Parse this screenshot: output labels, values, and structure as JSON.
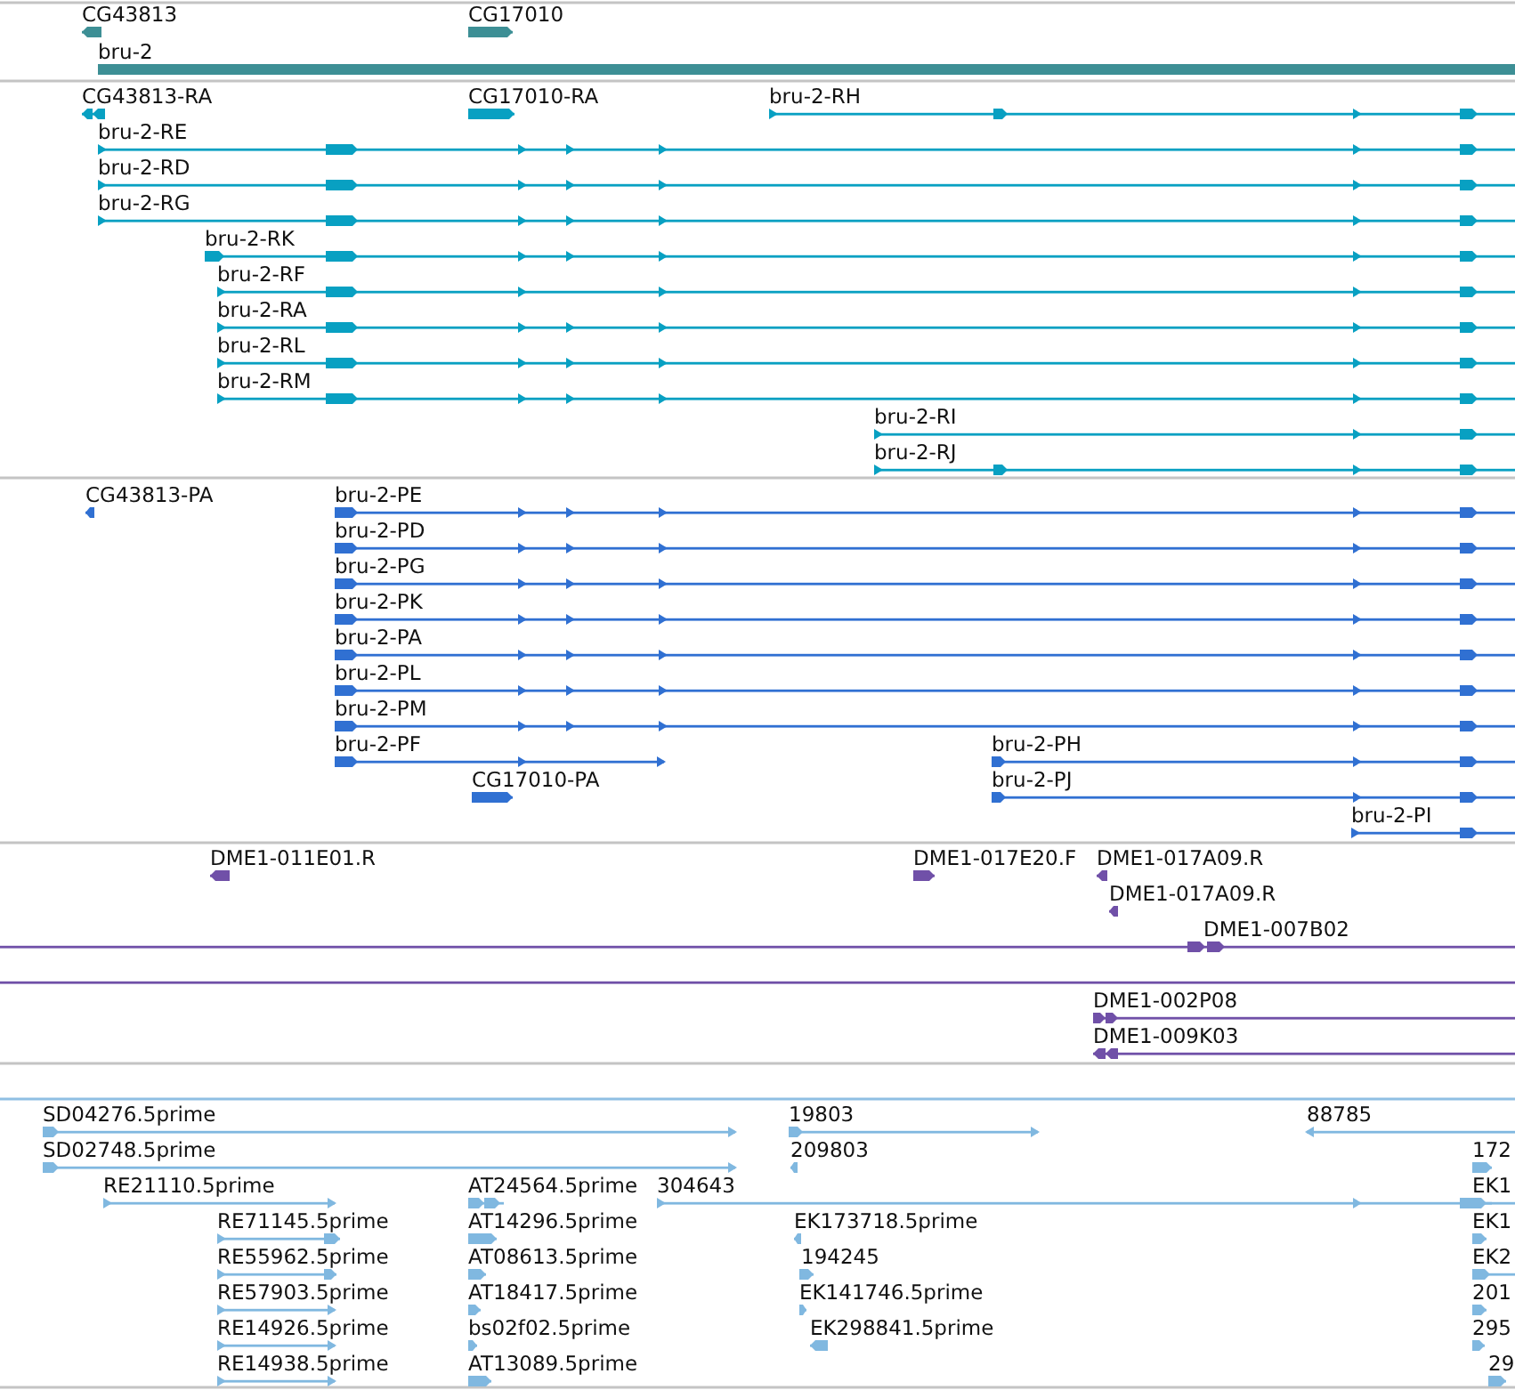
{
  "tracks": [
    {
      "color": "#3d8f95",
      "features": [
        {
          "label": "CG43813",
          "reverse": true
        },
        {
          "label": "CG17010",
          "reverse": false
        },
        {
          "label": "bru-2"
        }
      ]
    },
    {
      "color": "#08a0c2",
      "features": [
        {
          "label": "CG43813-RA",
          "reverse": true
        },
        {
          "label": "CG17010-RA",
          "reverse": false
        },
        {
          "label": "bru-2-RH",
          "reverse": false
        },
        {
          "label": "bru-2-RE",
          "reverse": false
        },
        {
          "label": "bru-2-RD",
          "reverse": false
        },
        {
          "label": "bru-2-RG",
          "reverse": false
        },
        {
          "label": "bru-2-RK",
          "reverse": false
        },
        {
          "label": "bru-2-RF",
          "reverse": false
        },
        {
          "label": "bru-2-RA",
          "reverse": false
        },
        {
          "label": "bru-2-RL",
          "reverse": false
        },
        {
          "label": "bru-2-RM",
          "reverse": false
        },
        {
          "label": "bru-2-RI",
          "reverse": false
        },
        {
          "label": "bru-2-RJ",
          "reverse": false
        }
      ]
    },
    {
      "color": "#3070d2",
      "features": [
        {
          "label": "CG43813-PA",
          "reverse": true
        },
        {
          "label": "bru-2-PE",
          "reverse": false
        },
        {
          "label": "bru-2-PD",
          "reverse": false
        },
        {
          "label": "bru-2-PG",
          "reverse": false
        },
        {
          "label": "bru-2-PK",
          "reverse": false
        },
        {
          "label": "bru-2-PA",
          "reverse": false
        },
        {
          "label": "bru-2-PL",
          "reverse": false
        },
        {
          "label": "bru-2-PM",
          "reverse": false
        },
        {
          "label": "bru-2-PF",
          "reverse": false
        },
        {
          "label": "bru-2-PH",
          "reverse": false
        },
        {
          "label": "CG17010-PA",
          "reverse": false
        },
        {
          "label": "bru-2-PJ",
          "reverse": false
        },
        {
          "label": "bru-2-PI",
          "reverse": false
        }
      ]
    },
    {
      "color": "#7050a8",
      "features": [
        {
          "label": "DME1-011E01.R",
          "reverse": true
        },
        {
          "label": "DME1-017E20.F",
          "reverse": false
        },
        {
          "label": "DME1-017A09.R",
          "reverse": true
        },
        {
          "label": "DME1-017A09.R",
          "reverse": true
        },
        {
          "label": "DME1-007B02",
          "reverse": false
        },
        {
          "kind": "line"
        },
        {
          "label": "DME1-002P08",
          "reverse": false
        },
        {
          "label": "DME1-009K03",
          "reverse": true
        }
      ]
    },
    {
      "color": "#80b8e0",
      "features": [
        {
          "label": "SD04276.5prime",
          "reverse": false
        },
        {
          "label": "19803",
          "reverse": false
        },
        {
          "label": "88785",
          "reverse": true
        },
        {
          "label": "SD02748.5prime",
          "reverse": false
        },
        {
          "label": "209803",
          "reverse": true
        },
        {
          "label": "172",
          "reverse": false
        },
        {
          "label": "RE21110.5prime",
          "reverse": false
        },
        {
          "label": "AT24564.5prime",
          "reverse": false
        },
        {
          "label": "304643",
          "reverse": false
        },
        {
          "label": "EK1",
          "reverse": false
        },
        {
          "label": "RE71145.5prime",
          "reverse": false
        },
        {
          "label": "AT14296.5prime",
          "reverse": false
        },
        {
          "label": "EK173718.5prime",
          "reverse": true
        },
        {
          "label": "EK1",
          "reverse": false
        },
        {
          "label": "RE55962.5prime",
          "reverse": false
        },
        {
          "label": "AT08613.5prime",
          "reverse": false
        },
        {
          "label": "194245",
          "reverse": false
        },
        {
          "label": "EK2",
          "reverse": false
        },
        {
          "label": "RE57903.5prime",
          "reverse": false
        },
        {
          "label": "AT18417.5prime",
          "reverse": false
        },
        {
          "label": "EK141746.5prime",
          "reverse": false
        },
        {
          "label": "201",
          "reverse": false
        },
        {
          "label": "RE14926.5prime",
          "reverse": false
        },
        {
          "label": "bs02f02.5prime",
          "reverse": false
        },
        {
          "label": "EK298841.5prime",
          "reverse": true
        },
        {
          "label": "295",
          "reverse": false
        },
        {
          "label": "RE14938.5prime",
          "reverse": false
        },
        {
          "label": "AT13089.5prime",
          "reverse": false
        },
        {
          "label": "29",
          "reverse": false
        }
      ]
    }
  ]
}
